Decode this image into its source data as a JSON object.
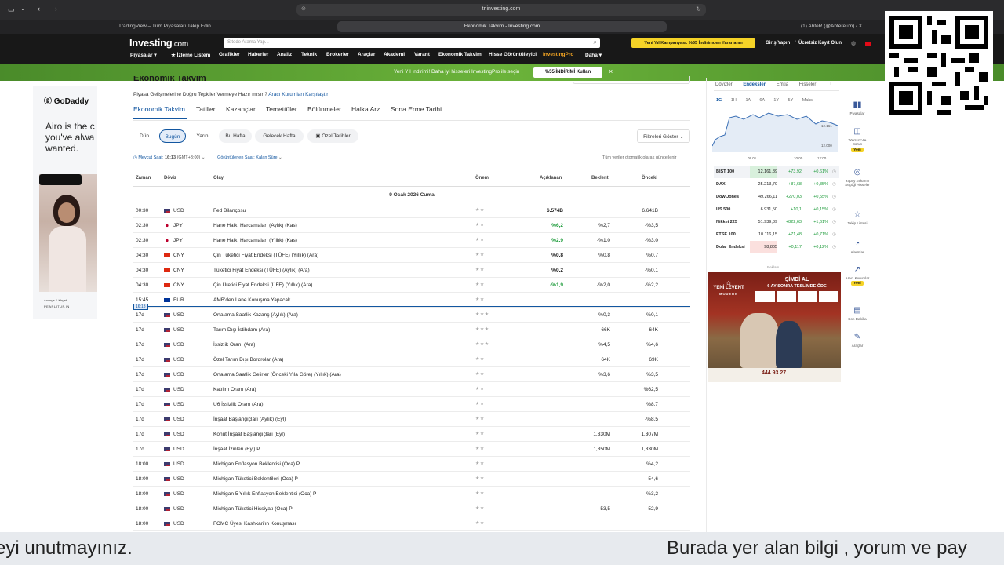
{
  "browser": {
    "url": "tr.investing.com",
    "tabs": [
      "TradingView – Tüm Piyasaları Takip Edin",
      "Ekonomik Takvim - Investing.com",
      "(1) AhteR (@Ahtereum) / X"
    ]
  },
  "site": {
    "logo": "Investing",
    "logo_suffix": ".com",
    "search_placeholder": "Sitede Arama Yap...",
    "campaign": "Yeni Yıl Kampanyası: %55 İndirimden Yararlanın",
    "login": "Giriş Yapın",
    "register": "Ücretsiz Kayıt Olun",
    "nav": [
      "Piyasalar",
      "İzleme Listem",
      "Grafikler",
      "Haberler",
      "Analiz",
      "Teknik",
      "Brokerler",
      "Araçlar",
      "Akademi",
      "Varant",
      "Ekonomik Takvim",
      "Hisse Görüntüleyici",
      "InvestingPro",
      "Daha"
    ],
    "promo_text": "Yeni Yıl İndirimi! Daha iyi hisseleri InvestingPro ile seçin",
    "promo_button": "%55 İNDİRİMİ Kullan"
  },
  "page": {
    "title": "Ekonomik Takvim",
    "subtitle": "Piyasa Gelişmelerine Doğru Tepkiler Vermeye Hazır mısın?",
    "subtitle_link": "Aracı Kurumları Karşılaştır",
    "tabs": [
      "Ekonomik Takvim",
      "Tatiller",
      "Kazançlar",
      "Temettüler",
      "Bölünmeler",
      "Halka Arz",
      "Sona Erme Tarihi"
    ],
    "filters": [
      "Dün",
      "Bugün",
      "Yarın",
      "Bu Hafta",
      "Gelecek Hafta",
      "Özel Tarihler"
    ],
    "filters_button": "Filtreleri Göster",
    "current_time_label": "Mevcut Saat:",
    "current_time": "16:13",
    "gmt": "(GMT+3:00)",
    "display_time": "Görüntülenen Saat: Kalan Süre",
    "auto_update": "Tüm veriler otomatik olarak güncellenir",
    "headers": [
      "Zaman",
      "Döviz",
      "Olay",
      "Önem",
      "Açıklanan",
      "Beklenti",
      "Önceki"
    ],
    "date": "9 Ocak 2026 Cuma",
    "now_marker": "16:13"
  },
  "events": [
    {
      "time": "00:30",
      "cur": "USD",
      "flag": "us",
      "event": "Fed Bilançosu",
      "stars": "★★",
      "actual": "6.574B",
      "actual_color": "#1a1a1a",
      "forecast": "",
      "previous": "6.641B"
    },
    {
      "time": "02:30",
      "cur": "JPY",
      "flag": "jp",
      "event": "Hane Halkı Harcamaları (Aylık) (Kas)",
      "stars": "★★",
      "actual": "%6,2",
      "actual_color": "#1d9b3a",
      "forecast": "%2,7",
      "previous": "-%3,5"
    },
    {
      "time": "02:30",
      "cur": "JPY",
      "flag": "jp",
      "event": "Hane Halkı Harcamaları (Yıllık) (Kas)",
      "stars": "★★",
      "actual": "%2,9",
      "actual_color": "#1d9b3a",
      "forecast": "-%1,0",
      "previous": "-%3,0"
    },
    {
      "time": "04:30",
      "cur": "CNY",
      "flag": "cn",
      "event": "Çin Tüketici Fiyat Endeksi (TÜFE) (Yıllık) (Ara)",
      "stars": "★★",
      "actual": "%0,8",
      "actual_color": "#1a1a1a",
      "forecast": "%0,8",
      "previous": "%0,7"
    },
    {
      "time": "04:30",
      "cur": "CNY",
      "flag": "cn",
      "event": "Tüketici Fiyat Endeksi (TÜFE) (Aylık) (Ara)",
      "stars": "★★",
      "actual": "%0,2",
      "actual_color": "#1a1a1a",
      "forecast": "",
      "previous": "-%0,1"
    },
    {
      "time": "04:30",
      "cur": "CNY",
      "flag": "cn",
      "event": "Çin Üretici Fiyat Endeksi (ÜFE) (Yıllık) (Ara)",
      "stars": "★★",
      "actual": "-%1,9",
      "actual_color": "#1d9b3a",
      "forecast": "-%2,0",
      "previous": "-%2,2"
    },
    {
      "time": "15:45",
      "cur": "EUR",
      "flag": "eu",
      "event": "AMB'den Lane Konuşma Yapacak",
      "stars": "★★",
      "actual": "",
      "actual_color": "#1a1a1a",
      "forecast": "",
      "previous": ""
    },
    {
      "time": "17d",
      "cur": "USD",
      "flag": "us",
      "event": "Ortalama Saatlik Kazanç (Aylık) (Ara)",
      "stars": "★★★",
      "actual": "",
      "actual_color": "#1a1a1a",
      "forecast": "%0,3",
      "previous": "%0,1"
    },
    {
      "time": "17d",
      "cur": "USD",
      "flag": "us",
      "event": "Tarım Dışı İstihdam  (Ara)",
      "stars": "★★★",
      "actual": "",
      "actual_color": "#1a1a1a",
      "forecast": "66K",
      "previous": "64K"
    },
    {
      "time": "17d",
      "cur": "USD",
      "flag": "us",
      "event": "İşsizlik Oranı  (Ara)",
      "stars": "★★★",
      "actual": "",
      "actual_color": "#1a1a1a",
      "forecast": "%4,5",
      "previous": "%4,6"
    },
    {
      "time": "17d",
      "cur": "USD",
      "flag": "us",
      "event": "Özel Tarım Dışı Bordrolar  (Ara)",
      "stars": "★★",
      "actual": "",
      "actual_color": "#1a1a1a",
      "forecast": "64K",
      "previous": "69K"
    },
    {
      "time": "17d",
      "cur": "USD",
      "flag": "us",
      "event": "Ortalama Saatlik Gelirler (Önceki Yıla Göre) (Yıllık) (Ara)",
      "stars": "★★",
      "actual": "",
      "actual_color": "#1a1a1a",
      "forecast": "%3,6",
      "previous": "%3,5"
    },
    {
      "time": "17d",
      "cur": "USD",
      "flag": "us",
      "event": "Katılım Oranı  (Ara)",
      "stars": "★★",
      "actual": "",
      "actual_color": "#1a1a1a",
      "forecast": "",
      "previous": "%62,5"
    },
    {
      "time": "17d",
      "cur": "USD",
      "flag": "us",
      "event": "U6 İşsizlik Oranı  (Ara)",
      "stars": "★★",
      "actual": "",
      "actual_color": "#1a1a1a",
      "forecast": "",
      "previous": "%8,7"
    },
    {
      "time": "17d",
      "cur": "USD",
      "flag": "us",
      "event": "İnşaat Başlangıçları (Aylık) (Eyl)",
      "stars": "★★",
      "actual": "",
      "actual_color": "#1a1a1a",
      "forecast": "",
      "previous": "-%8,5"
    },
    {
      "time": "17d",
      "cur": "USD",
      "flag": "us",
      "event": "Konut İnşaat Başlangıçları  (Eyl)",
      "stars": "★★",
      "actual": "",
      "actual_color": "#1a1a1a",
      "forecast": "1,330M",
      "previous": "1,307M"
    },
    {
      "time": "17d",
      "cur": "USD",
      "flag": "us",
      "event": "İnşaat İzinleri  (Eyl)   P",
      "stars": "★★",
      "actual": "",
      "actual_color": "#1a1a1a",
      "forecast": "1,350M",
      "previous": "1,330M"
    },
    {
      "time": "18:00",
      "cur": "USD",
      "flag": "us",
      "event": "Michigan Enflasyon Beklentisi  (Oca)   P",
      "stars": "★★",
      "actual": "",
      "actual_color": "#1a1a1a",
      "forecast": "",
      "previous": "%4,2"
    },
    {
      "time": "18:00",
      "cur": "USD",
      "flag": "us",
      "event": "Michigan Tüketici Beklentileri  (Oca)   P",
      "stars": "★★",
      "actual": "",
      "actual_color": "#1a1a1a",
      "forecast": "",
      "previous": "54,6"
    },
    {
      "time": "18:00",
      "cur": "USD",
      "flag": "us",
      "event": "Michigan 5 Yıllık Enflasyon Beklentisi  (Oca)   P",
      "stars": "★★",
      "actual": "",
      "actual_color": "#1a1a1a",
      "forecast": "",
      "previous": "%3,2"
    },
    {
      "time": "18:00",
      "cur": "USD",
      "flag": "us",
      "event": "Michigan Tüketici Hissiyatı  (Oca)   P",
      "stars": "★★",
      "actual": "",
      "actual_color": "#1a1a1a",
      "forecast": "53,5",
      "previous": "52,9"
    },
    {
      "time": "18:00",
      "cur": "USD",
      "flag": "us",
      "event": "FOMC Üyesi Kashkari'ın Konuşması",
      "stars": "★★",
      "actual": "",
      "actual_color": "#1a1a1a",
      "forecast": "",
      "previous": ""
    }
  ],
  "markets": {
    "tabs": [
      "Dövizler",
      "Endeksler",
      "Emtia",
      "Hisseler"
    ],
    "ranges": [
      "1G",
      "1H",
      "1A",
      "6A",
      "1Y",
      "5Y",
      "Maks."
    ],
    "chart_labels": [
      "12.161",
      "12.000"
    ],
    "chart_x": [
      "09.01",
      "10:00",
      "12:00"
    ],
    "indices": [
      {
        "name": "BIST 100",
        "last": "12.161,89",
        "chg": "+73,92",
        "pct": "+0,61%"
      },
      {
        "name": "DAX",
        "last": "25.213,79",
        "chg": "+87,68",
        "pct": "+0,35%"
      },
      {
        "name": "Dow Jones",
        "last": "49.266,11",
        "chg": "+270,03",
        "pct": "+0,55%"
      },
      {
        "name": "US 500",
        "last": "6.931,50",
        "chg": "+10,1",
        "pct": "+0,15%"
      },
      {
        "name": "Nikkei 225",
        "last": "51.939,89",
        "chg": "+822,63",
        "pct": "+1,61%"
      },
      {
        "name": "FTSE 100",
        "last": "10.116,15",
        "chg": "+71,48",
        "pct": "+0,71%"
      },
      {
        "name": "Dolar Endeksi",
        "last": "98,805",
        "chg": "+0,117",
        "pct": "+0,12%"
      }
    ],
    "ad_label": "Reklam"
  },
  "right_ad": {
    "l1": "ŞİMDİ AL",
    "l2": "6 AY SONRA TESLİMDE ÖDE",
    "brand": "YENİ LEVENT",
    "brand2": "MODERN",
    "phone": "444 93 27"
  },
  "left_ad": {
    "brand": "GoDaddy",
    "t1": "Airo   is the c",
    "t2": "you've alwa",
    "t3": "wanted.",
    "caption1": "Ananya & Khyati",
    "caption2": "PEARLITUP.IN"
  },
  "rail": [
    {
      "icon": "▮▮",
      "label": "Piyasalar"
    },
    {
      "icon": "◫",
      "label": "WarrenAI'a Sorun",
      "badge": "Yeni"
    },
    {
      "icon": "◎",
      "label": "Yapay Zekanın Seçtiği Hisseler"
    },
    {
      "icon": "☆",
      "label": "Takip Listesi"
    },
    {
      "icon": "◔",
      "label": "Alarmlar"
    },
    {
      "icon": "↗",
      "label": "Aracı Kurumlar",
      "badge": "Yeni"
    },
    {
      "icon": "▤",
      "label": "Son Dakika"
    },
    {
      "icon": "✎",
      "label": "Araçlar"
    }
  ],
  "subtitle": {
    "left": "eyi unutmayınız.",
    "right": "Burada yer alan bilgi , yorum ve pay"
  }
}
